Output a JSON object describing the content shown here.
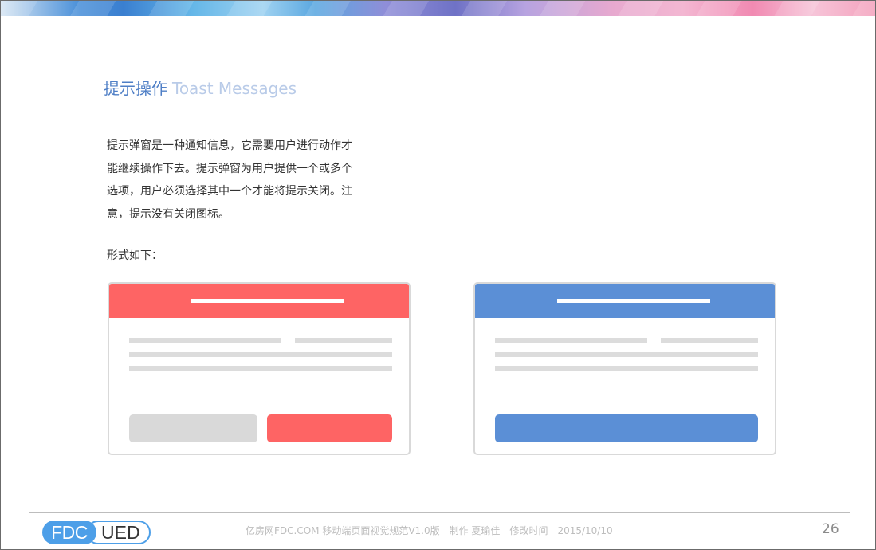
{
  "heading": {
    "zh": "提示操作",
    "en": "Toast Messages"
  },
  "description": "提示弹窗是一种通知信息，它需要用户进行动作才能继续操作下去。提示弹窗为用户提供一个或多个选项，用户必须选择其中一个才能将提示关闭。注意，提示没有关闭图标。",
  "form_label": "形式如下：",
  "examples": [
    {
      "variant": "two-button",
      "accent": "#fe6464",
      "button_colors": [
        "#d9d9d9",
        "#fe6464"
      ]
    },
    {
      "variant": "single-button",
      "accent": "#5b8fd6",
      "button_colors": [
        "#5b8fd6"
      ]
    }
  ],
  "footer": {
    "logo_left": "FDC",
    "logo_right": "UED",
    "text": "亿房网FDC.COM 移动端页面视觉规范V1.0版　制作 夏瑜佳　修改时间　2015/10/10",
    "page_number": "26"
  }
}
